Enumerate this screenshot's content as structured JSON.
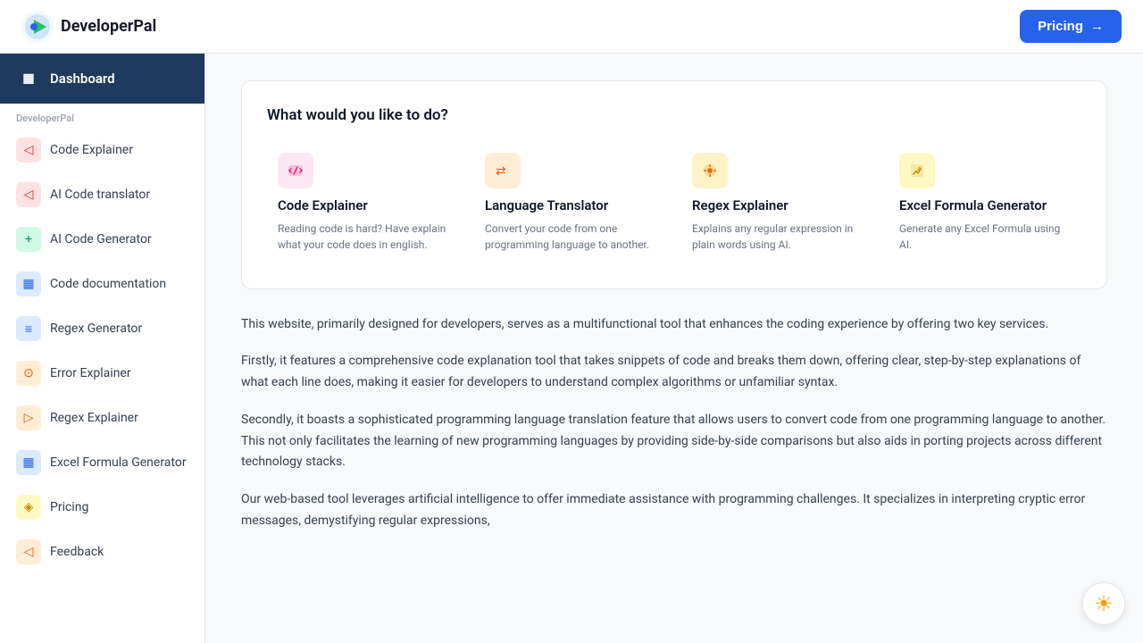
{
  "topnav": {
    "logo_text": "DeveloperPal",
    "pricing_button": "Pricing",
    "pricing_arrow": "→"
  },
  "sidebar": {
    "dashboard_label": "Dashboard",
    "section_label": "DeveloperPal",
    "items": [
      {
        "id": "code-explainer",
        "label": "Code Explainer",
        "icon_type": "red",
        "icon_char": "◁"
      },
      {
        "id": "ai-code-translator",
        "label": "AI Code translator",
        "icon_type": "red",
        "icon_char": "◁"
      },
      {
        "id": "ai-code-generator",
        "label": "AI Code Generator",
        "icon_type": "green",
        "icon_char": "+"
      },
      {
        "id": "code-documentation",
        "label": "Code documentation",
        "icon_type": "blue",
        "icon_char": "▦"
      },
      {
        "id": "regex-generator",
        "label": "Regex Generator",
        "icon_type": "blue",
        "icon_char": "≡"
      },
      {
        "id": "error-explainer",
        "label": "Error Explainer",
        "icon_type": "orange",
        "icon_char": "⊙"
      },
      {
        "id": "regex-explainer",
        "label": "Regex Explainer",
        "icon_type": "orange",
        "icon_char": "▷"
      },
      {
        "id": "excel-formula-generator",
        "label": "Excel Formula Generator",
        "icon_type": "blue",
        "icon_char": "▦"
      },
      {
        "id": "pricing",
        "label": "Pricing",
        "icon_type": "yellow",
        "icon_char": "◈"
      },
      {
        "id": "feedback",
        "label": "Feedback",
        "icon_type": "orange",
        "icon_char": "◁"
      }
    ]
  },
  "main": {
    "card_title": "What would you like to do?",
    "features": [
      {
        "id": "code-explainer",
        "name": "Code Explainer",
        "description": "Reading code is hard? Have explain what your code does in english.",
        "icon_type": "pink",
        "icon_char": "💬"
      },
      {
        "id": "language-translator",
        "name": "Language Translator",
        "description": "Convert your code from one programming language to another.",
        "icon_type": "orange",
        "icon_char": "⇄"
      },
      {
        "id": "regex-explainer",
        "name": "Regex Explainer",
        "description": "Explains any regular expression in plain words using AI.",
        "icon_type": "amber",
        "icon_char": "✦"
      },
      {
        "id": "excel-formula-generator",
        "name": "Excel Formula Generator",
        "description": "Generate any Excel Formula using AI.",
        "icon_type": "yellow",
        "icon_char": "✏"
      }
    ],
    "paragraphs": [
      "This website, primarily designed for developers, serves as a multifunctional tool that enhances the coding experience by offering two key services.",
      "Firstly, it features a comprehensive code explanation tool that takes snippets of code and breaks them down, offering clear, step-by-step explanations of what each line does, making it easier for developers to understand complex algorithms or unfamiliar syntax.",
      "Secondly, it boasts a sophisticated programming language translation feature that allows users to convert code from one programming language to another. This not only facilitates the learning of new programming languages by providing side-by-side comparisons but also aids in porting projects across different technology stacks.",
      "Our web-based tool leverages artificial intelligence to offer immediate assistance with programming challenges. It specializes in interpreting cryptic error messages, demystifying regular expressions,"
    ]
  },
  "theme_toggle": "☀"
}
